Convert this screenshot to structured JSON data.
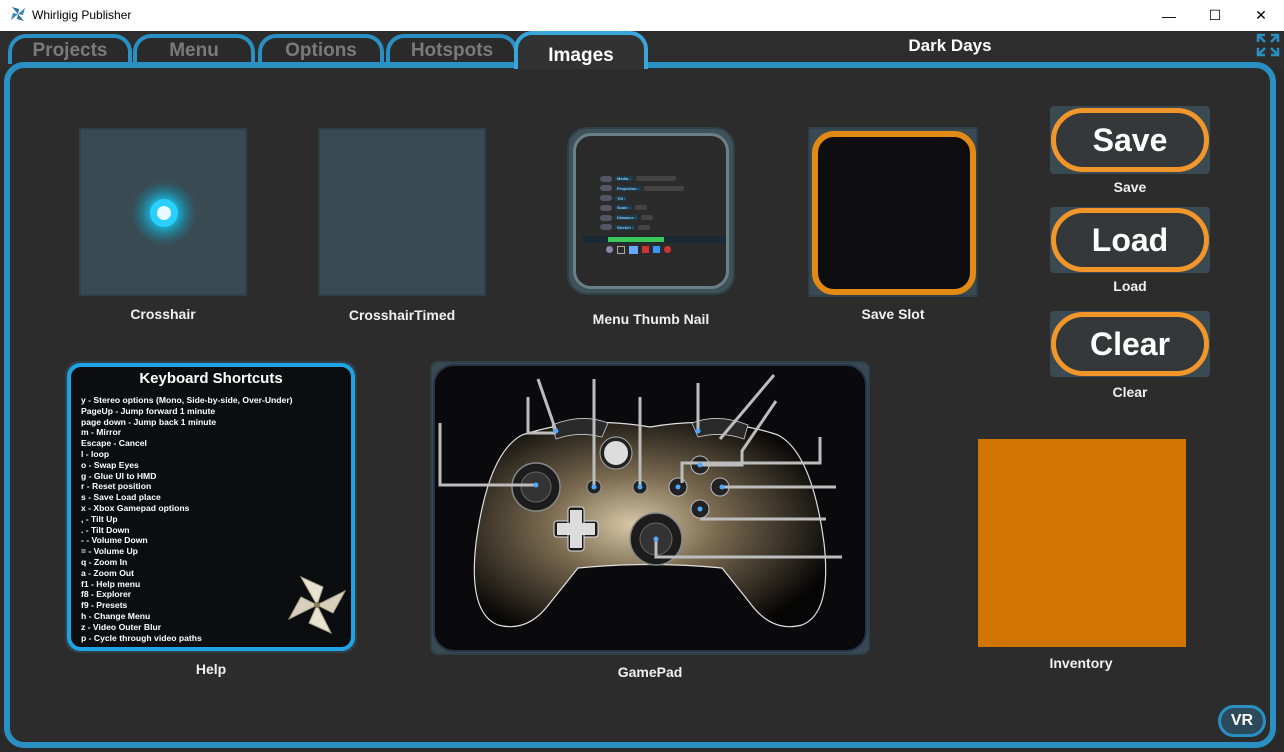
{
  "window": {
    "title": "Whirligig Publisher",
    "controls": {
      "minimize": "—",
      "maximize": "☐",
      "close": "✕"
    }
  },
  "tabs": [
    {
      "label": "Projects",
      "active": false
    },
    {
      "label": "Menu",
      "active": false
    },
    {
      "label": "Options",
      "active": false
    },
    {
      "label": "Hotspots",
      "active": false
    },
    {
      "label": "Images",
      "active": true
    }
  ],
  "document_title": "Dark Days",
  "colors": {
    "accent": "#2a8fc2",
    "orange": "#f0962a",
    "inventory": "#d27400",
    "help_border": "#1ea4e4"
  },
  "slots": {
    "crosshair": "Crosshair",
    "crosshair_timed": "CrosshairTimed",
    "menu_thumb": "Menu Thumb Nail",
    "save_slot": "Save Slot",
    "help": "Help",
    "gamepad": "GamePad",
    "inventory": "Inventory"
  },
  "menu_thumb_rows": [
    "Media :",
    "Projection :",
    "Tilt :",
    "Scale :",
    "Distance :",
    "Stretch :"
  ],
  "buttons": {
    "save": {
      "label": "Save",
      "caption": "Save"
    },
    "load": {
      "label": "Load",
      "caption": "Load"
    },
    "clear": {
      "label": "Clear",
      "caption": "Clear"
    }
  },
  "help": {
    "title": "Keyboard Shortcuts",
    "lines": [
      "y - Stereo options (Mono, Side-by-side, Over-Under)",
      "PageUp - Jump forward 1 minute",
      "page down - Jump back 1 minute",
      "m - Mirror",
      "Escape - Cancel",
      "l - loop",
      "o - Swap Eyes",
      "g - Glue UI to HMD",
      "r - Reset position",
      "s - Save Load place",
      "x - Xbox Gamepad options",
      ", - Tilt Up",
      ". - Tilt Down",
      "- - Volume Down",
      "= - Volume Up",
      "q - Zoom In",
      "a - Zoom Out",
      "f1 - Help menu",
      "f8 - Explorer",
      "f9 - Presets",
      "h - Change Menu",
      "z - Video Outer Blur",
      "p - Cycle through video paths"
    ]
  },
  "vr_label": "VR"
}
